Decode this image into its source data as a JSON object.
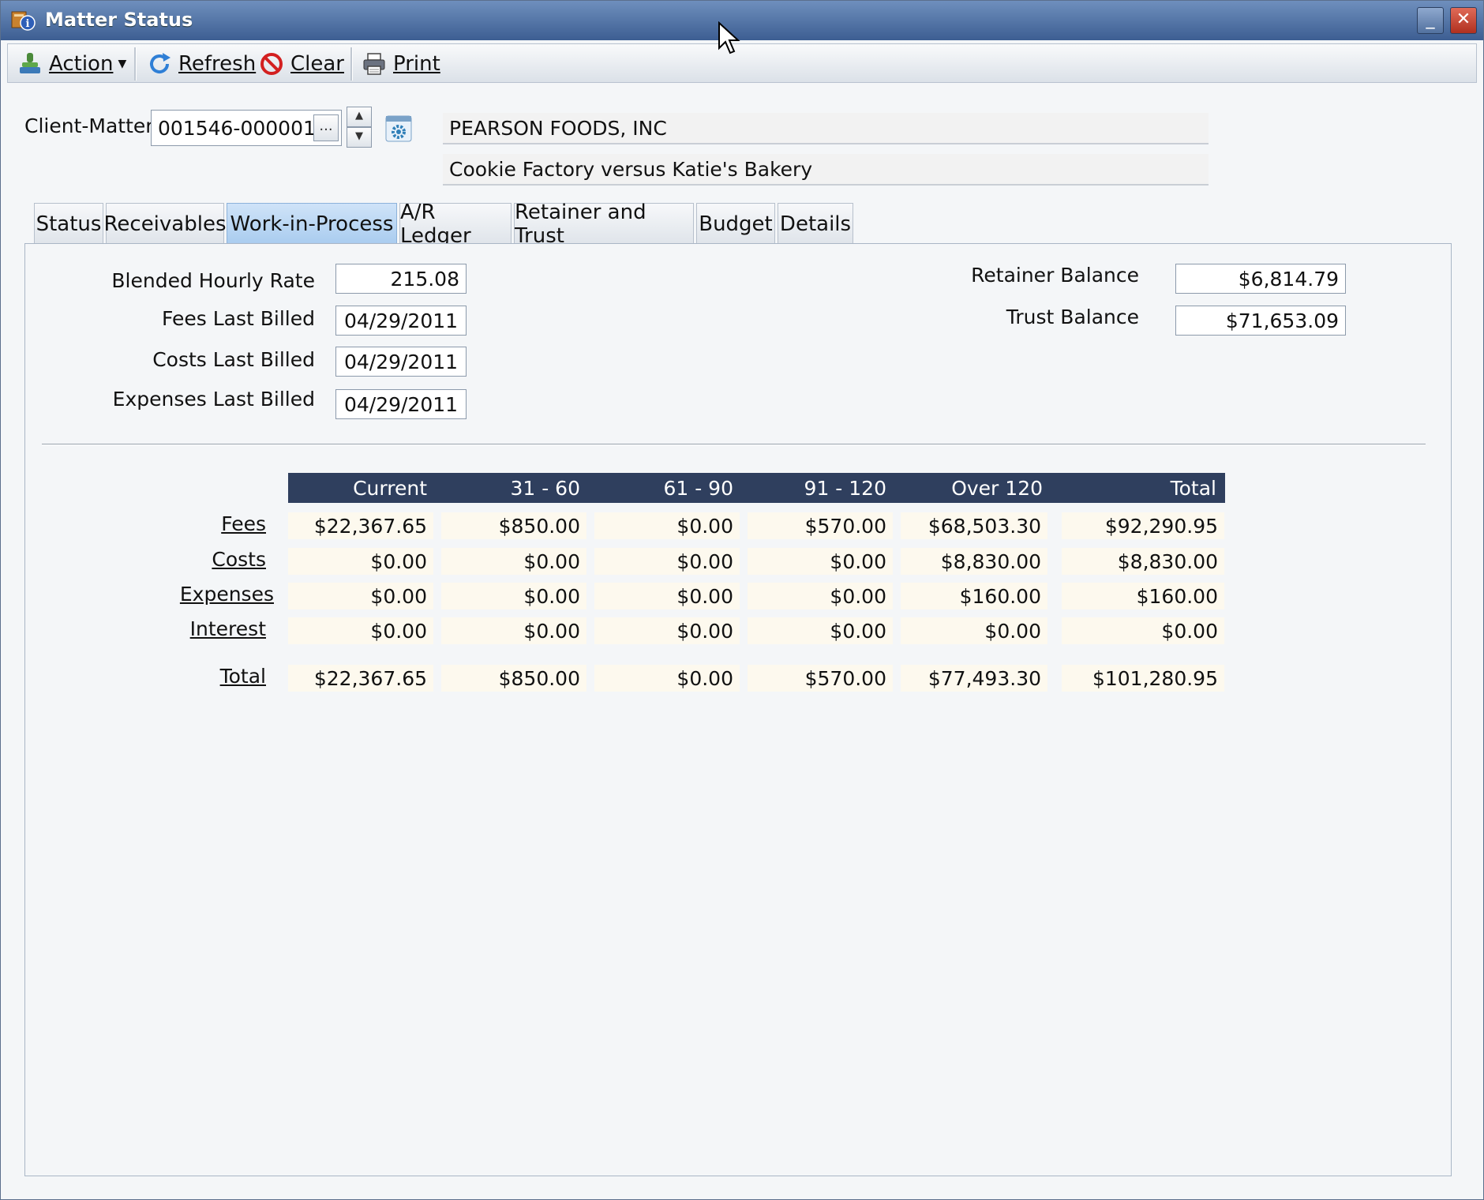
{
  "window": {
    "title": "Matter Status",
    "minimize_glyph": "_",
    "close_glyph": "✕"
  },
  "toolbar": {
    "action_label": "Action",
    "refresh_label": "Refresh",
    "clear_label": "Clear",
    "print_label": "Print"
  },
  "client_matter": {
    "label": "Client-Matter",
    "value": "001546-000001",
    "browse_label": "...",
    "client_name": "PEARSON FOODS, INC",
    "matter_name": "Cookie Factory versus Katie's Bakery"
  },
  "tabs": [
    {
      "label": "Status"
    },
    {
      "label": "Receivables"
    },
    {
      "label": "Work-in-Process"
    },
    {
      "label": "A/R Ledger"
    },
    {
      "label": "Retainer and Trust"
    },
    {
      "label": "Budget"
    },
    {
      "label": "Details"
    }
  ],
  "active_tab": "Work-in-Process",
  "summary": {
    "blended_rate_label": "Blended Hourly Rate",
    "blended_rate": "215.08",
    "fees_last_billed_label": "Fees Last Billed",
    "fees_last_billed": "04/29/2011",
    "costs_last_billed_label": "Costs Last Billed",
    "costs_last_billed": "04/29/2011",
    "expenses_last_billed_label": "Expenses Last Billed",
    "expenses_last_billed": "04/29/2011",
    "retainer_balance_label": "Retainer Balance",
    "retainer_balance": "$6,814.79",
    "trust_balance_label": "Trust Balance",
    "trust_balance": "$71,653.09"
  },
  "aging": {
    "columns": [
      "Current",
      "31 - 60",
      "61 - 90",
      "91 - 120",
      "Over 120",
      "Total"
    ],
    "rows": [
      {
        "label": "Fees",
        "values": [
          "$22,367.65",
          "$850.00",
          "$0.00",
          "$570.00",
          "$68,503.30",
          "$92,290.95"
        ]
      },
      {
        "label": "Costs",
        "values": [
          "$0.00",
          "$0.00",
          "$0.00",
          "$0.00",
          "$8,830.00",
          "$8,830.00"
        ]
      },
      {
        "label": "Expenses",
        "values": [
          "$0.00",
          "$0.00",
          "$0.00",
          "$0.00",
          "$160.00",
          "$160.00"
        ]
      },
      {
        "label": "Interest",
        "values": [
          "$0.00",
          "$0.00",
          "$0.00",
          "$0.00",
          "$0.00",
          "$0.00"
        ]
      },
      {
        "label": "Total",
        "values": [
          "$22,367.65",
          "$850.00",
          "$0.00",
          "$570.00",
          "$77,493.30",
          "$101,280.95"
        ]
      }
    ]
  },
  "icons": {
    "app": "matter-status-icon",
    "action": "stamp-icon",
    "refresh": "refresh-icon",
    "clear": "prohibited-icon",
    "print": "printer-icon",
    "settings": "gear-icon"
  }
}
